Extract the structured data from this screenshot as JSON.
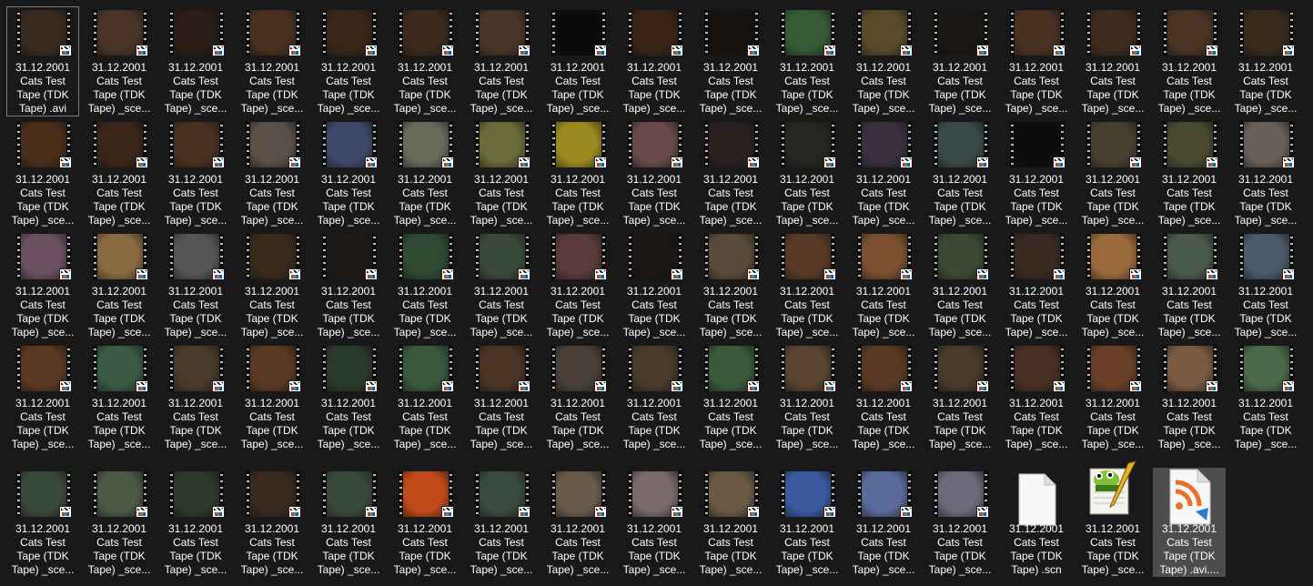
{
  "files": [
    {
      "lines": [
        "31.12.2001",
        "Cats Test",
        "Tape (TDK",
        "Tape) .avi"
      ],
      "type": "video",
      "thumb": "#3a2a1e",
      "state": "outline"
    },
    {
      "lines": [
        "31.12.2001",
        "Cats Test",
        "Tape (TDK",
        "Tape) _sce..."
      ],
      "type": "video",
      "thumb": "#4a3428"
    },
    {
      "lines": [
        "31.12.2001",
        "Cats Test",
        "Tape (TDK",
        "Tape) _sce..."
      ],
      "type": "video",
      "thumb": "#2a1e16"
    },
    {
      "lines": [
        "31.12.2001",
        "Cats Test",
        "Tape (TDK",
        "Tape) _sce..."
      ],
      "type": "video",
      "thumb": "#4a3020"
    },
    {
      "lines": [
        "31.12.2001",
        "Cats Test",
        "Tape (TDK",
        "Tape) _sce..."
      ],
      "type": "video",
      "thumb": "#3a2618"
    },
    {
      "lines": [
        "31.12.2001",
        "Cats Test",
        "Tape (TDK",
        "Tape) _sce..."
      ],
      "type": "video",
      "thumb": "#3d2a1c"
    },
    {
      "lines": [
        "31.12.2001",
        "Cats Test",
        "Tape (TDK",
        "Tape) _sce..."
      ],
      "type": "video",
      "thumb": "#4a3628"
    },
    {
      "lines": [
        "31.12.2001",
        "Cats Test",
        "Tape (TDK",
        "Tape) _sce..."
      ],
      "type": "video",
      "thumb": "#0a0a0a"
    },
    {
      "lines": [
        "31.12.2001",
        "Cats Test",
        "Tape (TDK",
        "Tape) _sce..."
      ],
      "type": "video",
      "thumb": "#3a2416"
    },
    {
      "lines": [
        "31.12.2001",
        "Cats Test",
        "Tape (TDK",
        "Tape) _sce..."
      ],
      "type": "video",
      "thumb": "#161210"
    },
    {
      "lines": [
        "31.12.2001",
        "Cats Test",
        "Tape (TDK",
        "Tape) _sce..."
      ],
      "type": "video",
      "thumb": "#365a36"
    },
    {
      "lines": [
        "31.12.2001",
        "Cats Test",
        "Tape (TDK",
        "Tape) _sce..."
      ],
      "type": "video",
      "thumb": "#5a4a2a"
    },
    {
      "lines": [
        "31.12.2001",
        "Cats Test",
        "Tape (TDK",
        "Tape) _sce..."
      ],
      "type": "video",
      "thumb": "#1a1612"
    },
    {
      "lines": [
        "31.12.2001",
        "Cats Test",
        "Tape (TDK",
        "Tape) _sce..."
      ],
      "type": "video",
      "thumb": "#4a3222"
    },
    {
      "lines": [
        "31.12.2001",
        "Cats Test",
        "Tape (TDK",
        "Tape) _sce..."
      ],
      "type": "video",
      "thumb": "#3e2c1e"
    },
    {
      "lines": [
        "31.12.2001",
        "Cats Test",
        "Tape (TDK",
        "Tape) _sce..."
      ],
      "type": "video",
      "thumb": "#4a3424"
    },
    {
      "lines": [
        "31.12.2001",
        "Cats Test",
        "Tape (TDK",
        "Tape) _sce..."
      ],
      "type": "video",
      "thumb": "#3a2a1c"
    },
    {
      "lines": [
        "31.12.2001",
        "Cats Test",
        "Tape (TDK",
        "Tape) _sce..."
      ],
      "type": "video",
      "thumb": "#4a2e1a"
    },
    {
      "lines": [
        "31.12.2001",
        "Cats Test",
        "Tape (TDK",
        "Tape) _sce..."
      ],
      "type": "video",
      "thumb": "#3a2618"
    },
    {
      "lines": [
        "31.12.2001",
        "Cats Test",
        "Tape (TDK",
        "Tape) _sce..."
      ],
      "type": "video",
      "thumb": "#4a3020"
    },
    {
      "lines": [
        "31.12.2001",
        "Cats Test",
        "Tape (TDK",
        "Tape) _sce..."
      ],
      "type": "video",
      "thumb": "#5a5048"
    },
    {
      "lines": [
        "31.12.2001",
        "Cats Test",
        "Tape (TDK",
        "Tape) _sce..."
      ],
      "type": "video",
      "thumb": "#3e4a6a"
    },
    {
      "lines": [
        "31.12.2001",
        "Cats Test",
        "Tape (TDK",
        "Tape) _sce..."
      ],
      "type": "video",
      "thumb": "#6a6a5a"
    },
    {
      "lines": [
        "31.12.2001",
        "Cats Test",
        "Tape (TDK",
        "Tape) _sce..."
      ],
      "type": "video",
      "thumb": "#6a6a3a"
    },
    {
      "lines": [
        "31.12.2001",
        "Cats Test",
        "Tape (TDK",
        "Tape) _sce..."
      ],
      "type": "video",
      "thumb": "#9a8a20"
    },
    {
      "lines": [
        "31.12.2001",
        "Cats Test",
        "Tape (TDK",
        "Tape) _sce..."
      ],
      "type": "video",
      "thumb": "#6a4a4a"
    },
    {
      "lines": [
        "31.12.2001",
        "Cats Test",
        "Tape (TDK",
        "Tape) _sce..."
      ],
      "type": "video",
      "thumb": "#2a2020"
    },
    {
      "lines": [
        "31.12.2001",
        "Cats Test",
        "Tape (TDK",
        "Tape) _sce..."
      ],
      "type": "video",
      "thumb": "#262620"
    },
    {
      "lines": [
        "31.12.2001",
        "Cats Test",
        "Tape (TDK",
        "Tape) _sce..."
      ],
      "type": "video",
      "thumb": "#3a3040"
    },
    {
      "lines": [
        "31.12.2001",
        "Cats Test",
        "Tape (TDK",
        "Tape) _sce..."
      ],
      "type": "video",
      "thumb": "#3a4a4a"
    },
    {
      "lines": [
        "31.12.2001",
        "Cats Test",
        "Tape (TDK",
        "Tape) _sce..."
      ],
      "type": "video",
      "thumb": "#0c0c0c"
    },
    {
      "lines": [
        "31.12.2001",
        "Cats Test",
        "Tape (TDK",
        "Tape) _sce..."
      ],
      "type": "video",
      "thumb": "#4a4030"
    },
    {
      "lines": [
        "31.12.2001",
        "Cats Test",
        "Tape (TDK",
        "Tape) _sce..."
      ],
      "type": "video",
      "thumb": "#4a4a30"
    },
    {
      "lines": [
        "31.12.2001",
        "Cats Test",
        "Tape (TDK",
        "Tape) _sce..."
      ],
      "type": "video",
      "thumb": "#6a6058"
    },
    {
      "lines": [
        "31.12.2001",
        "Cats Test",
        "Tape (TDK",
        "Tape) _sce..."
      ],
      "type": "video",
      "thumb": "#6a5060"
    },
    {
      "lines": [
        "31.12.2001",
        "Cats Test",
        "Tape (TDK",
        "Tape) _sce..."
      ],
      "type": "video",
      "thumb": "#8a6a40"
    },
    {
      "lines": [
        "31.12.2001",
        "Cats Test",
        "Tape (TDK",
        "Tape) _sce..."
      ],
      "type": "video",
      "thumb": "#555555"
    },
    {
      "lines": [
        "31.12.2001",
        "Cats Test",
        "Tape (TDK",
        "Tape) _sce..."
      ],
      "type": "video",
      "thumb": "#3a2a1c"
    },
    {
      "lines": [
        "31.12.2001",
        "Cats Test",
        "Tape (TDK",
        "Tape) _sce..."
      ],
      "type": "video",
      "thumb": "#1e1a18"
    },
    {
      "lines": [
        "31.12.2001",
        "Cats Test",
        "Tape (TDK",
        "Tape) _sce..."
      ],
      "type": "video",
      "thumb": "#2e4a32"
    },
    {
      "lines": [
        "31.12.2001",
        "Cats Test",
        "Tape (TDK",
        "Tape) _sce..."
      ],
      "type": "video",
      "thumb": "#3a4a3a"
    },
    {
      "lines": [
        "31.12.2001",
        "Cats Test",
        "Tape (TDK",
        "Tape) _sce..."
      ],
      "type": "video",
      "thumb": "#5a3a3a"
    },
    {
      "lines": [
        "31.12.2001",
        "Cats Test",
        "Tape (TDK",
        "Tape) _sce..."
      ],
      "type": "video",
      "thumb": "#1c1614"
    },
    {
      "lines": [
        "31.12.2001",
        "Cats Test",
        "Tape (TDK",
        "Tape) _sce..."
      ],
      "type": "video",
      "thumb": "#5a4a3a"
    },
    {
      "lines": [
        "31.12.2001",
        "Cats Test",
        "Tape (TDK",
        "Tape) _sce..."
      ],
      "type": "video",
      "thumb": "#5a3a26"
    },
    {
      "lines": [
        "31.12.2001",
        "Cats Test",
        "Tape (TDK",
        "Tape) _sce..."
      ],
      "type": "video",
      "thumb": "#7a5030"
    },
    {
      "lines": [
        "31.12.2001",
        "Cats Test",
        "Tape (TDK",
        "Tape) _sce..."
      ],
      "type": "video",
      "thumb": "#3a4a34"
    },
    {
      "lines": [
        "31.12.2001",
        "Cats Test",
        "Tape (TDK",
        "Tape) _sce..."
      ],
      "type": "video",
      "thumb": "#3a2a22"
    },
    {
      "lines": [
        "31.12.2001",
        "Cats Test",
        "Tape (TDK",
        "Tape) _sce..."
      ],
      "type": "video",
      "thumb": "#9a6a3a"
    },
    {
      "lines": [
        "31.12.2001",
        "Cats Test",
        "Tape (TDK",
        "Tape) _sce..."
      ],
      "type": "video",
      "thumb": "#4a5a4a"
    },
    {
      "lines": [
        "31.12.2001",
        "Cats Test",
        "Tape (TDK",
        "Tape) _sce..."
      ],
      "type": "video",
      "thumb": "#4a5a6a"
    },
    {
      "lines": [
        "31.12.2001",
        "Cats Test",
        "Tape (TDK",
        "Tape) _sce..."
      ],
      "type": "video",
      "thumb": "#5a3a22"
    },
    {
      "lines": [
        "31.12.2001",
        "Cats Test",
        "Tape (TDK",
        "Tape) _sce..."
      ],
      "type": "video",
      "thumb": "#3a5a44"
    },
    {
      "lines": [
        "31.12.2001",
        "Cats Test",
        "Tape (TDK",
        "Tape) _sce..."
      ],
      "type": "video",
      "thumb": "#4a3a2a"
    },
    {
      "lines": [
        "31.12.2001",
        "Cats Test",
        "Tape (TDK",
        "Tape) _sce..."
      ],
      "type": "video",
      "thumb": "#5a3a22"
    },
    {
      "lines": [
        "31.12.2001",
        "Cats Test",
        "Tape (TDK",
        "Tape) _sce..."
      ],
      "type": "video",
      "thumb": "#2a3a2a"
    },
    {
      "lines": [
        "31.12.2001",
        "Cats Test",
        "Tape (TDK",
        "Tape) _sce..."
      ],
      "type": "video",
      "thumb": "#3a5a3e"
    },
    {
      "lines": [
        "31.12.2001",
        "Cats Test",
        "Tape (TDK",
        "Tape) _sce..."
      ],
      "type": "video",
      "thumb": "#4a3424"
    },
    {
      "lines": [
        "31.12.2001",
        "Cats Test",
        "Tape (TDK",
        "Tape) _sce..."
      ],
      "type": "video",
      "thumb": "#4a4038"
    },
    {
      "lines": [
        "31.12.2001",
        "Cats Test",
        "Tape (TDK",
        "Tape) _sce..."
      ],
      "type": "video",
      "thumb": "#4a3a2a"
    },
    {
      "lines": [
        "31.12.2001",
        "Cats Test",
        "Tape (TDK",
        "Tape) _sce..."
      ],
      "type": "video",
      "thumb": "#3a5a3a"
    },
    {
      "lines": [
        "31.12.2001",
        "Cats Test",
        "Tape (TDK",
        "Tape) _sce..."
      ],
      "type": "video",
      "thumb": "#5a4432"
    },
    {
      "lines": [
        "31.12.2001",
        "Cats Test",
        "Tape (TDK",
        "Tape) _sce..."
      ],
      "type": "video",
      "thumb": "#5a3a22"
    },
    {
      "lines": [
        "31.12.2001",
        "Cats Test",
        "Tape (TDK",
        "Tape) _sce..."
      ],
      "type": "video",
      "thumb": "#4a3a2a"
    },
    {
      "lines": [
        "31.12.2001",
        "Cats Test",
        "Tape (TDK",
        "Tape) _sce..."
      ],
      "type": "video",
      "thumb": "#4a3022"
    },
    {
      "lines": [
        "31.12.2001",
        "Cats Test",
        "Tape (TDK",
        "Tape) _sce..."
      ],
      "type": "video",
      "thumb": "#6a4028"
    },
    {
      "lines": [
        "31.12.2001",
        "Cats Test",
        "Tape (TDK",
        "Tape) _sce..."
      ],
      "type": "video",
      "thumb": "#7a5a40"
    },
    {
      "lines": [
        "31.12.2001",
        "Cats Test",
        "Tape (TDK",
        "Tape) _sce..."
      ],
      "type": "video",
      "thumb": "#4a6a4a"
    },
    {
      "lines": [
        "31.12.2001",
        "Cats Test",
        "Tape (TDK",
        "Tape) _sce..."
      ],
      "type": "video",
      "thumb": "#3a4a38"
    },
    {
      "lines": [
        "31.12.2001",
        "Cats Test",
        "Tape (TDK",
        "Tape) _sce..."
      ],
      "type": "video",
      "thumb": "#4a5a44"
    },
    {
      "lines": [
        "31.12.2001",
        "Cats Test",
        "Tape (TDK",
        "Tape) _sce..."
      ],
      "type": "video",
      "thumb": "#2e3a2a"
    },
    {
      "lines": [
        "31.12.2001",
        "Cats Test",
        "Tape (TDK",
        "Tape) _sce..."
      ],
      "type": "video",
      "thumb": "#3a2a20"
    },
    {
      "lines": [
        "31.12.2001",
        "Cats Test",
        "Tape (TDK",
        "Tape) _sce..."
      ],
      "type": "video",
      "thumb": "#3a4a3a"
    },
    {
      "lines": [
        "31.12.2001",
        "Cats Test",
        "Tape (TDK",
        "Tape) _sce..."
      ],
      "type": "video",
      "thumb": "#c04a1a"
    },
    {
      "lines": [
        "31.12.2001",
        "Cats Test",
        "Tape (TDK",
        "Tape) _sce..."
      ],
      "type": "video",
      "thumb": "#3a4a3e"
    },
    {
      "lines": [
        "31.12.2001",
        "Cats Test",
        "Tape (TDK",
        "Tape) _sce..."
      ],
      "type": "video",
      "thumb": "#6a5a4a"
    },
    {
      "lines": [
        "31.12.2001",
        "Cats Test",
        "Tape (TDK",
        "Tape) _sce..."
      ],
      "type": "video",
      "thumb": "#7a6a6a"
    },
    {
      "lines": [
        "31.12.2001",
        "Cats Test",
        "Tape (TDK",
        "Tape) _sce..."
      ],
      "type": "video",
      "thumb": "#6a5a44"
    },
    {
      "lines": [
        "31.12.2001",
        "Cats Test",
        "Tape (TDK",
        "Tape) _sce..."
      ],
      "type": "video",
      "thumb": "#3a5aa0"
    },
    {
      "lines": [
        "31.12.2001",
        "Cats Test",
        "Tape (TDK",
        "Tape) _sce..."
      ],
      "type": "video",
      "thumb": "#5a6a9a"
    },
    {
      "lines": [
        "31.12.2001",
        "Cats Test",
        "Tape (TDK",
        "Tape) _sce..."
      ],
      "type": "video",
      "thumb": "#6a6a7a"
    },
    {
      "lines": [
        "31.12.2001",
        "Cats Test",
        "Tape (TDK",
        "Tape) .scn"
      ],
      "type": "blank"
    },
    {
      "lines": [
        "31.12.2001",
        "Cats Test",
        "Tape (TDK",
        "Tape) _sce..."
      ],
      "type": "notepad"
    },
    {
      "lines": [
        "31.12.2001",
        "Cats Test",
        "Tape (TDK",
        "Tape) .avi...."
      ],
      "type": "rss",
      "state": "fill"
    }
  ],
  "colors": {
    "background": "#191919",
    "selection_fill": "#4d4d4d",
    "selection_outline": "#7a7a7a",
    "text": "#ffffff",
    "rss_orange": "#e8702a",
    "vscode_blue": "#2a7ed2"
  }
}
